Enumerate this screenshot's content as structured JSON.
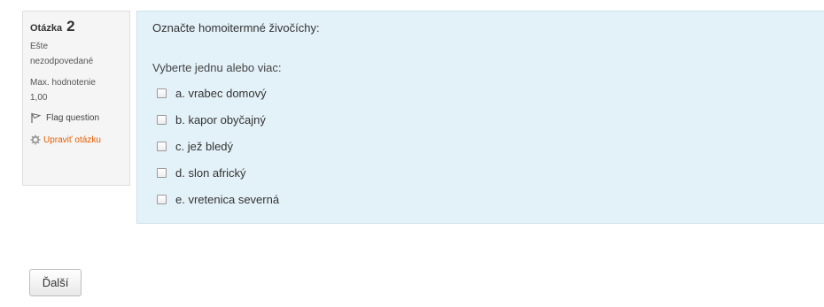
{
  "question_info": {
    "label": "Otázka",
    "number": "2",
    "state_line1": "Ešte",
    "state_line2": "nezodpovedané",
    "grade_label": "Max. hodnotenie",
    "grade_value": "1,00",
    "flag_label": "Flag question",
    "edit_label": "Upraviť otázku",
    "edit_color": "#e65e00"
  },
  "question": {
    "text": "Označte homoitermné živočíchy:",
    "prompt": "Vyberte jednu alebo viac:",
    "answers": [
      {
        "label": "a. vrabec domový",
        "checked": false
      },
      {
        "label": "b. kapor obyčajný",
        "checked": false
      },
      {
        "label": "c. jež bledý",
        "checked": false
      },
      {
        "label": "d. slon africký",
        "checked": false
      },
      {
        "label": "e. vretenica severná",
        "checked": false
      }
    ],
    "background_color": "#e3f1f8"
  },
  "navigation": {
    "next_label": "Ďalší"
  }
}
